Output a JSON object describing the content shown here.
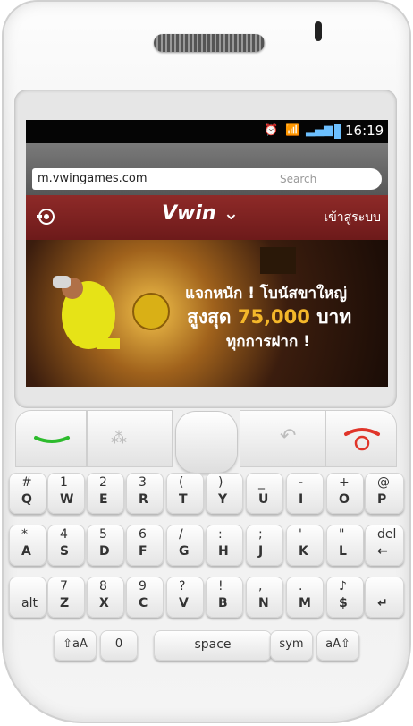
{
  "status_bar": {
    "time": "16:19"
  },
  "browser": {
    "url": "m.vwingames.com",
    "search_placeholder": "Search"
  },
  "site_nav": {
    "logo": "Vwin",
    "login_label": "เข้าสู่ระบบ"
  },
  "banner": {
    "line1": "แจกหนัก ! โบนัสขาใหญ่",
    "line2_prefix": "สูงสุด",
    "line2_amount": "75,000",
    "line2_suffix": "บาท",
    "line3": "ทุกการฝาก !"
  },
  "keyboard": {
    "row1": [
      {
        "top": "#",
        "bot": "Q"
      },
      {
        "top": "1",
        "bot": "W"
      },
      {
        "top": "2",
        "bot": "E"
      },
      {
        "top": "3",
        "bot": "R"
      },
      {
        "top": "(",
        "bot": "T"
      },
      {
        "top": ")",
        "bot": "Y"
      },
      {
        "top": "_",
        "bot": "U"
      },
      {
        "top": "-",
        "bot": "I"
      },
      {
        "top": "+",
        "bot": "O"
      },
      {
        "top": "@",
        "bot": "P"
      }
    ],
    "row2": [
      {
        "top": "*",
        "bot": "A"
      },
      {
        "top": "4",
        "bot": "S"
      },
      {
        "top": "5",
        "bot": "D"
      },
      {
        "top": "6",
        "bot": "F"
      },
      {
        "top": "/",
        "bot": "G"
      },
      {
        "top": ":",
        "bot": "H"
      },
      {
        "top": ";",
        "bot": "J"
      },
      {
        "top": "'",
        "bot": "K"
      },
      {
        "top": "\"",
        "bot": "L"
      },
      {
        "top": "del",
        "bot": "←"
      }
    ],
    "row3": [
      {
        "top": "",
        "bot": "alt"
      },
      {
        "top": "7",
        "bot": "Z"
      },
      {
        "top": "8",
        "bot": "X"
      },
      {
        "top": "9",
        "bot": "C"
      },
      {
        "top": "?",
        "bot": "V"
      },
      {
        "top": "!",
        "bot": "B"
      },
      {
        "top": ",",
        "bot": "N"
      },
      {
        "top": ".",
        "bot": "M"
      },
      {
        "top": "♪",
        "bot": "$"
      },
      {
        "top": "",
        "bot": "↵"
      }
    ],
    "row4": [
      {
        "label": "⇧aA"
      },
      {
        "label": "0"
      },
      {
        "label": "space"
      },
      {
        "label": "sym"
      },
      {
        "label": "aA⇧"
      }
    ]
  },
  "colors": {
    "nav_bg": "#7a1f1f",
    "status_icon": "#6cc0ff",
    "call_green": "#2dbb2d",
    "end_red": "#e0352a"
  }
}
